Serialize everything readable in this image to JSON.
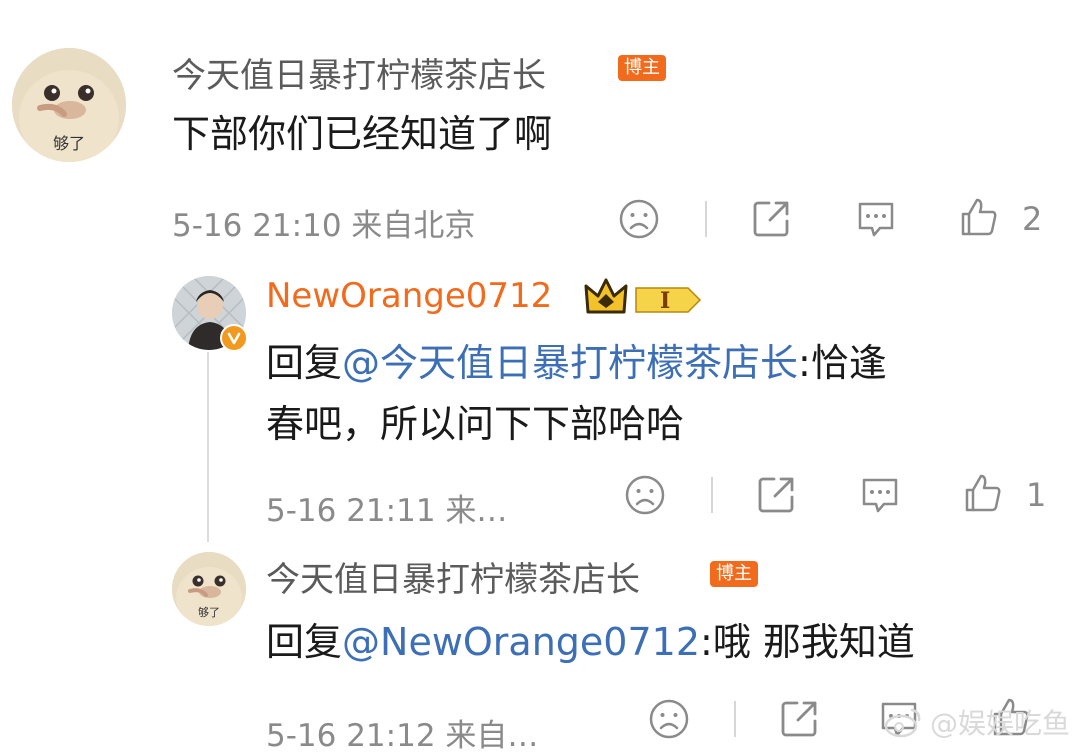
{
  "comments": [
    {
      "username": "今天值日暴打柠檬茶店长",
      "badge": "博主",
      "avatar_text": "够了",
      "content": "下部你们已经知道了啊",
      "meta": "5-16 21:10 来自北京",
      "likes": "2"
    },
    {
      "username": "NewOrange0712",
      "vip_level": "I",
      "reply_prefix": "回复",
      "mention": "@今天值日暴打柠檬茶店长",
      "text_line1": ":恰逢",
      "text_line2": "春吧，所以问下下部哈哈",
      "meta": "5-16 21:11 来…",
      "likes": "1"
    },
    {
      "username": "今天值日暴打柠檬茶店长",
      "badge": "博主",
      "avatar_text": "够了",
      "reply_prefix": "回复",
      "mention": "@NewOrange0712",
      "text": ":哦 那我知道",
      "meta": "5-16 21:12 来自…"
    }
  ],
  "watermark": "@娱娱吃鱼",
  "colors": {
    "orange_badge": "#f26a1b",
    "mention_blue": "#3c6fb6",
    "meta_gray": "#8a8a8a",
    "gold_crown": "#f3c22a"
  },
  "icons": [
    "dislike-face-icon",
    "share-icon",
    "comment-icon",
    "thumbs-up-icon",
    "crown-icon",
    "verified-icon"
  ]
}
